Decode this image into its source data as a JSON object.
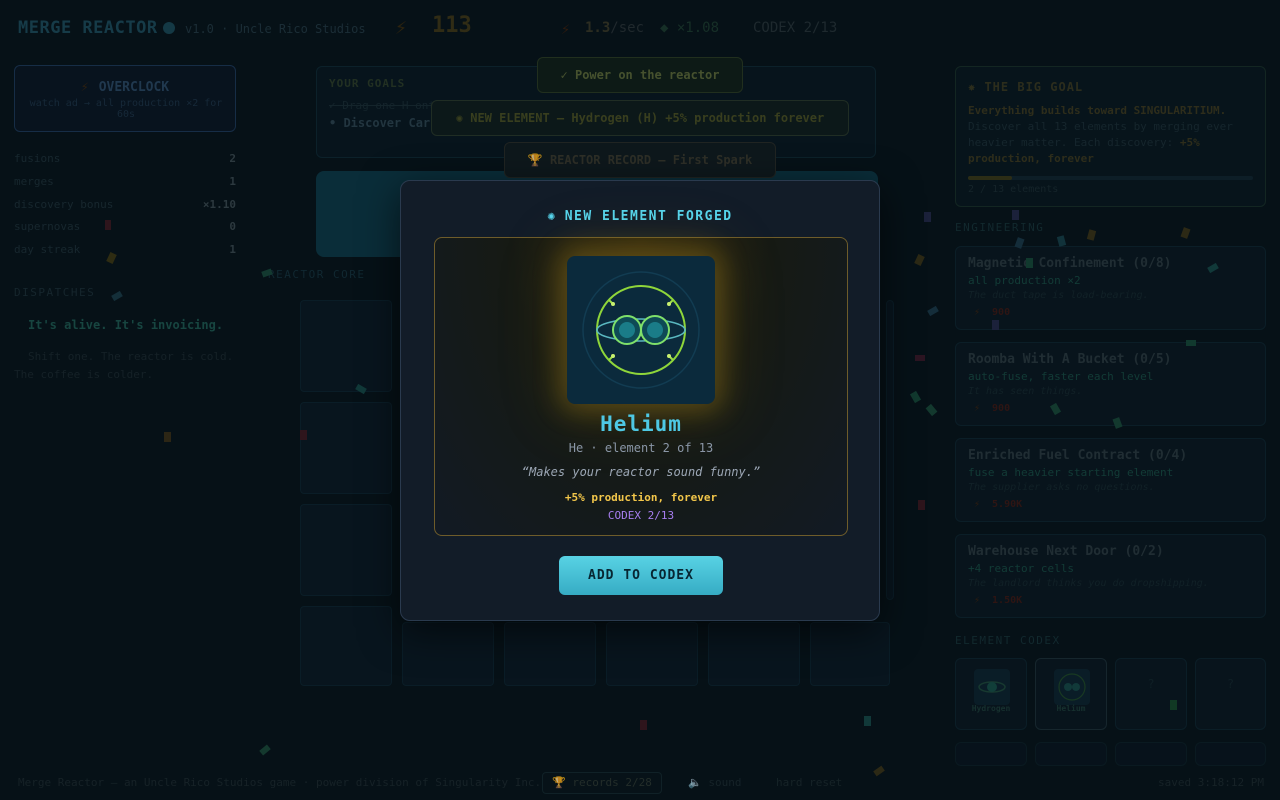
{
  "header": {
    "title": "MERGE REACTOR",
    "version": "v1.0 · Uncle Rico Studios",
    "energy": "113",
    "rate_value": "1.3",
    "rate_unit": "/sec",
    "multiplier": "×1.08",
    "codex": "CODEX 2/13"
  },
  "left": {
    "overclock_title": "OVERCLOCK",
    "overclock_desc": "watch ad → all production ×2 for 60s",
    "stats": [
      {
        "label": "fusions",
        "value": "2"
      },
      {
        "label": "merges",
        "value": "1"
      },
      {
        "label": "discovery bonus",
        "value": "×1.10"
      },
      {
        "label": "supernovas",
        "value": "0"
      },
      {
        "label": "day streak",
        "value": "1"
      }
    ],
    "dispatches_title": "DISPATCHES",
    "dispatches": [
      "It's alive. It's invoicing.",
      "Shift one. The reactor is cold. The coffee is colder."
    ]
  },
  "center": {
    "goals_title": "YOUR GOALS",
    "goals": [
      "✓ Drag one H onto another",
      "• Discover Carbon"
    ],
    "reactor_core_label": "REACTOR CORE"
  },
  "toasts": [
    {
      "icon": "✓",
      "text": "Power on the reactor"
    },
    {
      "icon": "✺",
      "text": "NEW ELEMENT — Hydrogen (H) +5% production forever"
    },
    {
      "icon": "🏆",
      "text": "REACTOR RECORD — First Spark"
    }
  ],
  "right": {
    "big_goal_title": "THE BIG GOAL",
    "big_goal_lead": "Everything builds toward SINGULARITIUM.",
    "big_goal_body": "Discover all 13 elements by merging ever heavier matter. Each discovery: ",
    "big_goal_bonus": "+5% production, forever",
    "big_goal_progress": 0.154,
    "big_goal_count": "2 / 13 elements",
    "engineering_title": "ENGINEERING",
    "upgrades": [
      {
        "name": "Magnetic Confinement (0/8)",
        "effect": "all production ×2",
        "flavor": "The duct tape is load-bearing.",
        "cost": "900"
      },
      {
        "name": "Roomba With A Bucket (0/5)",
        "effect": "auto-fuse, faster each level",
        "flavor": "It has seen things.",
        "cost": "900"
      },
      {
        "name": "Enriched Fuel Contract (0/4)",
        "effect": "fuse a heavier starting element",
        "flavor": "The supplier asks no questions.",
        "cost": "5.90K"
      },
      {
        "name": "Warehouse Next Door (0/2)",
        "effect": "+4 reactor cells",
        "flavor": "The landlord thinks you do dropshipping.",
        "cost": "1.50K"
      }
    ],
    "codex_title": "ELEMENT CODEX",
    "codex_cards": [
      {
        "label": "Hydrogen"
      },
      {
        "label": "Helium"
      },
      {
        "label": "?"
      },
      {
        "label": "?"
      }
    ]
  },
  "modal": {
    "title": "NEW ELEMENT FORGED",
    "element_name": "Helium",
    "element_sub": "He · element 2 of 13",
    "element_quote": "“Makes your reactor sound funny.”",
    "element_bonus": "+5% production, forever",
    "element_codex": "CODEX 2/13",
    "button": "ADD TO CODEX"
  },
  "footer": {
    "text": "Merge Reactor — an Uncle Rico Studios game · power division of Singularity Inc.",
    "records": "records 2/28",
    "sound": "sound",
    "reset": "hard reset",
    "saved": "saved 3:18:12 PM"
  },
  "colors": {
    "accent": "#56d6ee",
    "gold": "#f2c64a",
    "codex_purple": "#a77ef0",
    "button": "#46bfd6",
    "modal_bg": "#121c28"
  }
}
